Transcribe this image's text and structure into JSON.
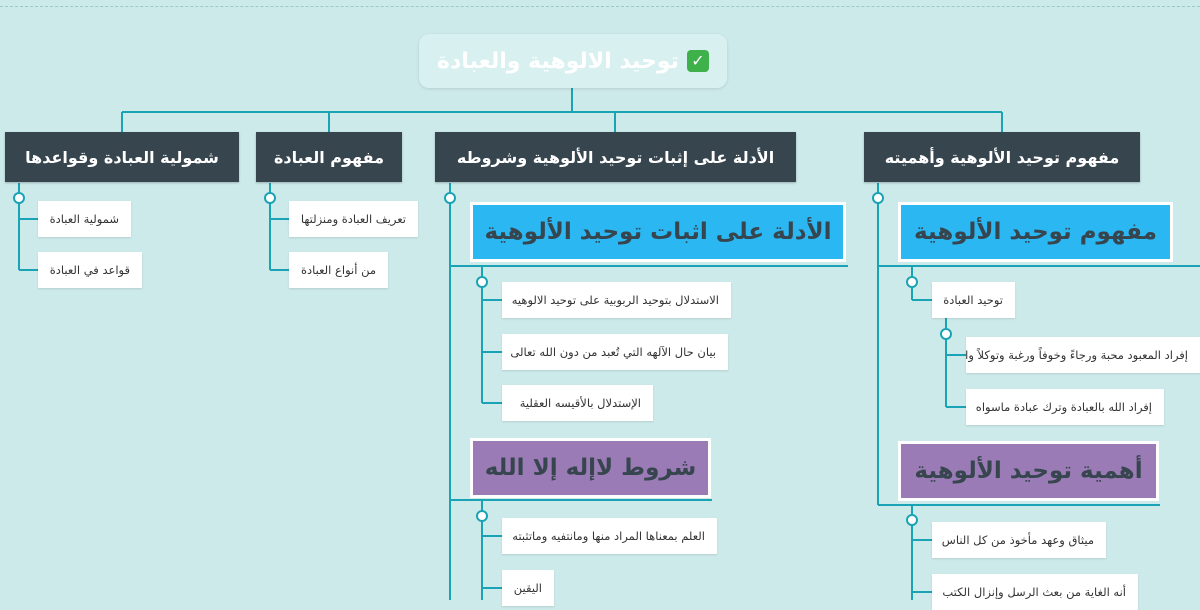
{
  "root": {
    "title": "توحيد الالوهية والعبادة",
    "icon": "check-mark-icon",
    "icon_glyph": "✓",
    "icon_color": "#3fb14a"
  },
  "branches": {
    "shumuliya": "شمولية العبادة وقواعدها",
    "mafhum_ibada": "مفهوم العبادة",
    "adilla": "الأدلة على إثبات توحيد الألوهية وشروطه",
    "mafhum_uluhiya": "مفهوم توحيد الألوهية وأهميته"
  },
  "shumuliya_leaves": [
    "شمولية العبادة",
    "قواعد في العبادة"
  ],
  "mafhum_ibada_leaves": [
    "تعريف العبادة ومنزلتها",
    "من أنواع العبادة"
  ],
  "adilla": {
    "box1": "الأدلة على اثبات توحيد الألوهية",
    "box1_leaves": [
      "الاستدلال بتوحيد الربوبية على توحيد الالوهيه",
      "بيان حال الآلهه التي تُعبد من دون الله تعالى",
      "الإستدلال بالأقيسه العقلية"
    ],
    "box2": "شروط لاإله إلا الله",
    "box2_leaves": [
      "العلم بمعناها المراد منها ومانتفيه وماتثبته",
      "اليقين"
    ]
  },
  "uluhiya": {
    "box1": "مفهوم توحيد الألوهية",
    "leaf1": "توحيد العبادة",
    "subleaves": [
      "إفراد المعبود محبة ورجاءً وخوفاً ورغبة وتوكلاً واستعانة",
      "إفراد الله بالعبادة وترك عبادة ماسواه"
    ],
    "box2": "أهمية توحيد الألوهية",
    "box2_leaves": [
      "ميثاق وعهد مأخوذ من كل الناس",
      "أنه الغاية من بعث الرسل وإنزال الكتب"
    ]
  },
  "colors": {
    "line": "#1aa3b5",
    "branch_bg": "#37454f",
    "blue_box": "#2bb7f2",
    "purple_box": "#9a7bb5",
    "background": "#cdeaea"
  }
}
